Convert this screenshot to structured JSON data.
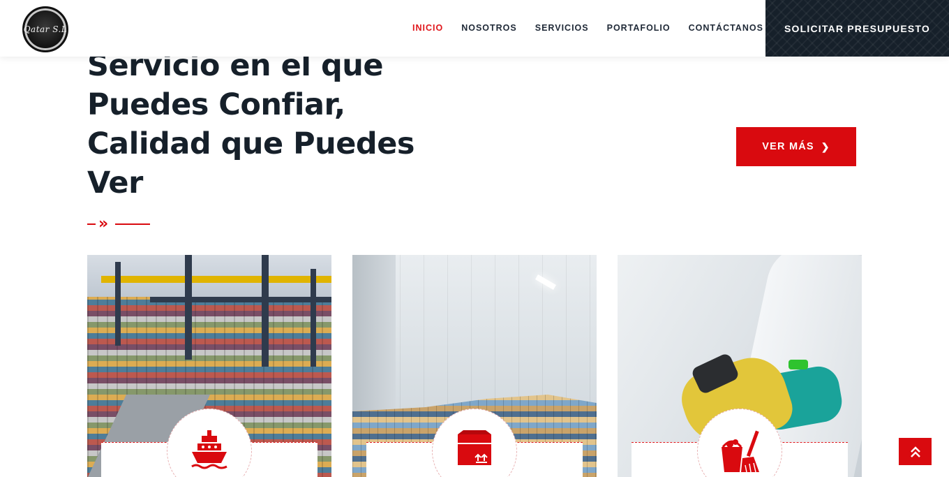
{
  "header": {
    "logo_text": "Qatar S.L",
    "nav": [
      {
        "label": "INICIO",
        "active": true
      },
      {
        "label": "NOSOTROS",
        "active": false
      },
      {
        "label": "SERVICIOS",
        "active": false
      },
      {
        "label": "PORTAFOLIO",
        "active": false
      },
      {
        "label": "CONTÁCTANOS",
        "active": false
      }
    ],
    "cta_label": "SOLICITAR PRESUPUESTO"
  },
  "hero": {
    "headline_lines": [
      "Servicio en el que",
      "Puedes Confiar,",
      "Calidad que Puedes",
      "Ver"
    ],
    "button_label": "VER MÁS",
    "button_icon": "chevron-right-icon",
    "divider_icon": "double-chevron-right-icon"
  },
  "cards": [
    {
      "image": "container-port-photo",
      "icon": "ship-icon"
    },
    {
      "image": "cold-storage-warehouse-photo",
      "icon": "package-box-icon"
    },
    {
      "image": "cleaning-glove-photo",
      "icon": "bucket-broom-icon"
    }
  ],
  "scroll_top_icon": "double-chevron-up-icon",
  "colors": {
    "accent": "#d90a0f",
    "dark": "#16202a",
    "text": "#1f2937"
  }
}
